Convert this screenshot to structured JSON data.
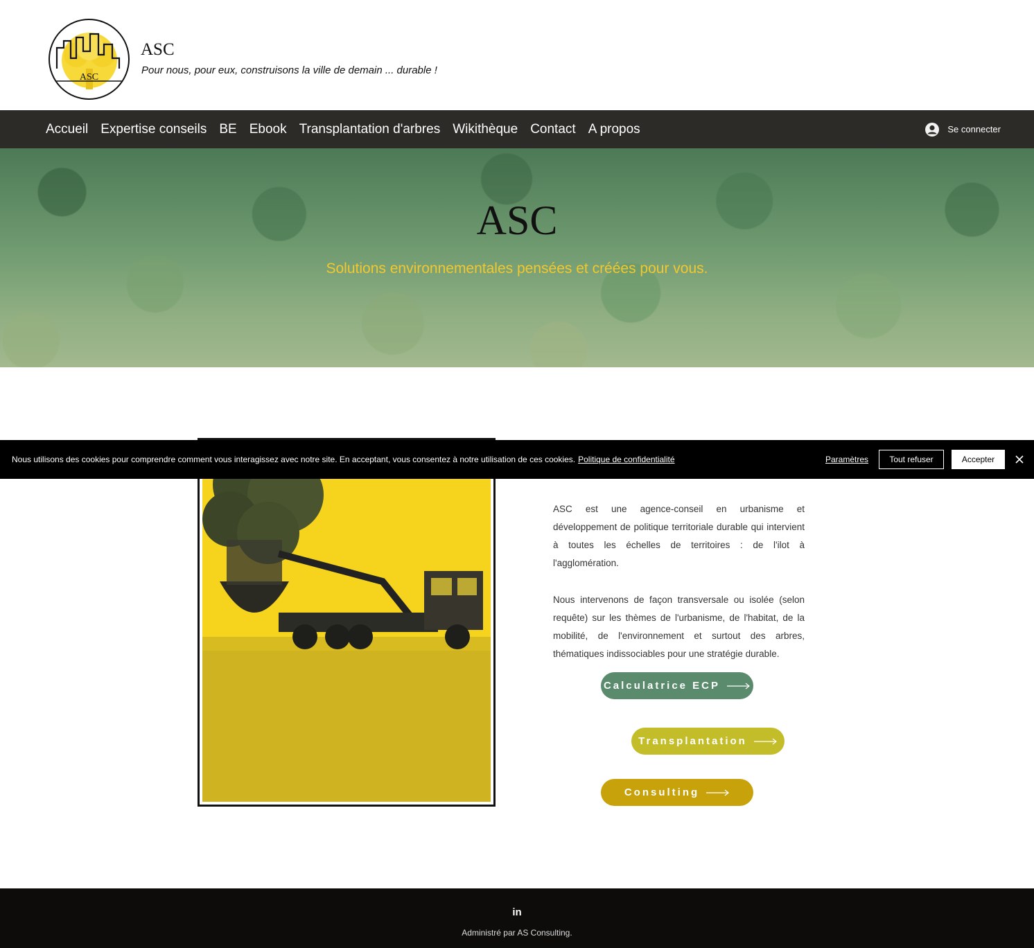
{
  "header": {
    "logo_text": "ASC",
    "site_title": "ASC",
    "tagline": "Pour nous, pour eux, construisons la ville de demain ... durable !"
  },
  "nav": {
    "items": [
      "Accueil",
      "Expertise conseils",
      "BE",
      "Ebook",
      "Transplantation d'arbres",
      "Wikithèque",
      "Contact",
      "A propos"
    ],
    "login_label": "Se connecter"
  },
  "hero": {
    "title": "ASC",
    "subtitle": "Solutions environnementales pensées et créées pour vous."
  },
  "main": {
    "paragraph_1": "ASC est une agence-conseil en urbanisme et développement de politique territoriale durable qui intervient à toutes les échelles de territoires : de l'ilot à l'agglomération.",
    "paragraph_2": " Nous intervenons de façon transversale ou isolée (selon requête) sur les thèmes de l'urbanisme, de l'habitat, de la mobilité, de l'environnement et surtout des arbres, thématiques indissociables pour une stratégie durable.",
    "buttons": {
      "calculatrice": "Calculatrice ECP",
      "transplantation": "Transplantation",
      "consulting": "Consulting"
    }
  },
  "cookie_banner": {
    "text": "Nous utilisons des cookies pour comprendre comment vous interagissez avec notre site. En acceptant, vous consentez à notre utilisation de ces cookies.",
    "policy_link": "Politique de confidentialité",
    "params_label": "Paramètres",
    "refuse_label": "Tout refuser",
    "accept_label": "Accepter"
  },
  "footer": {
    "social_icon": "linkedin-icon",
    "linkedin_glyph": "in",
    "text": "Administré par AS Consulting."
  },
  "colors": {
    "nav_bg": "#2d2b28",
    "hero_subtitle": "#f2c82e",
    "btn_calc": "#5a8b6d",
    "btn_trans": "#c2bd29",
    "btn_cons": "#c7a20b",
    "photo_yellow": "#f3d11b",
    "footer_bg": "#0d0c0b"
  }
}
